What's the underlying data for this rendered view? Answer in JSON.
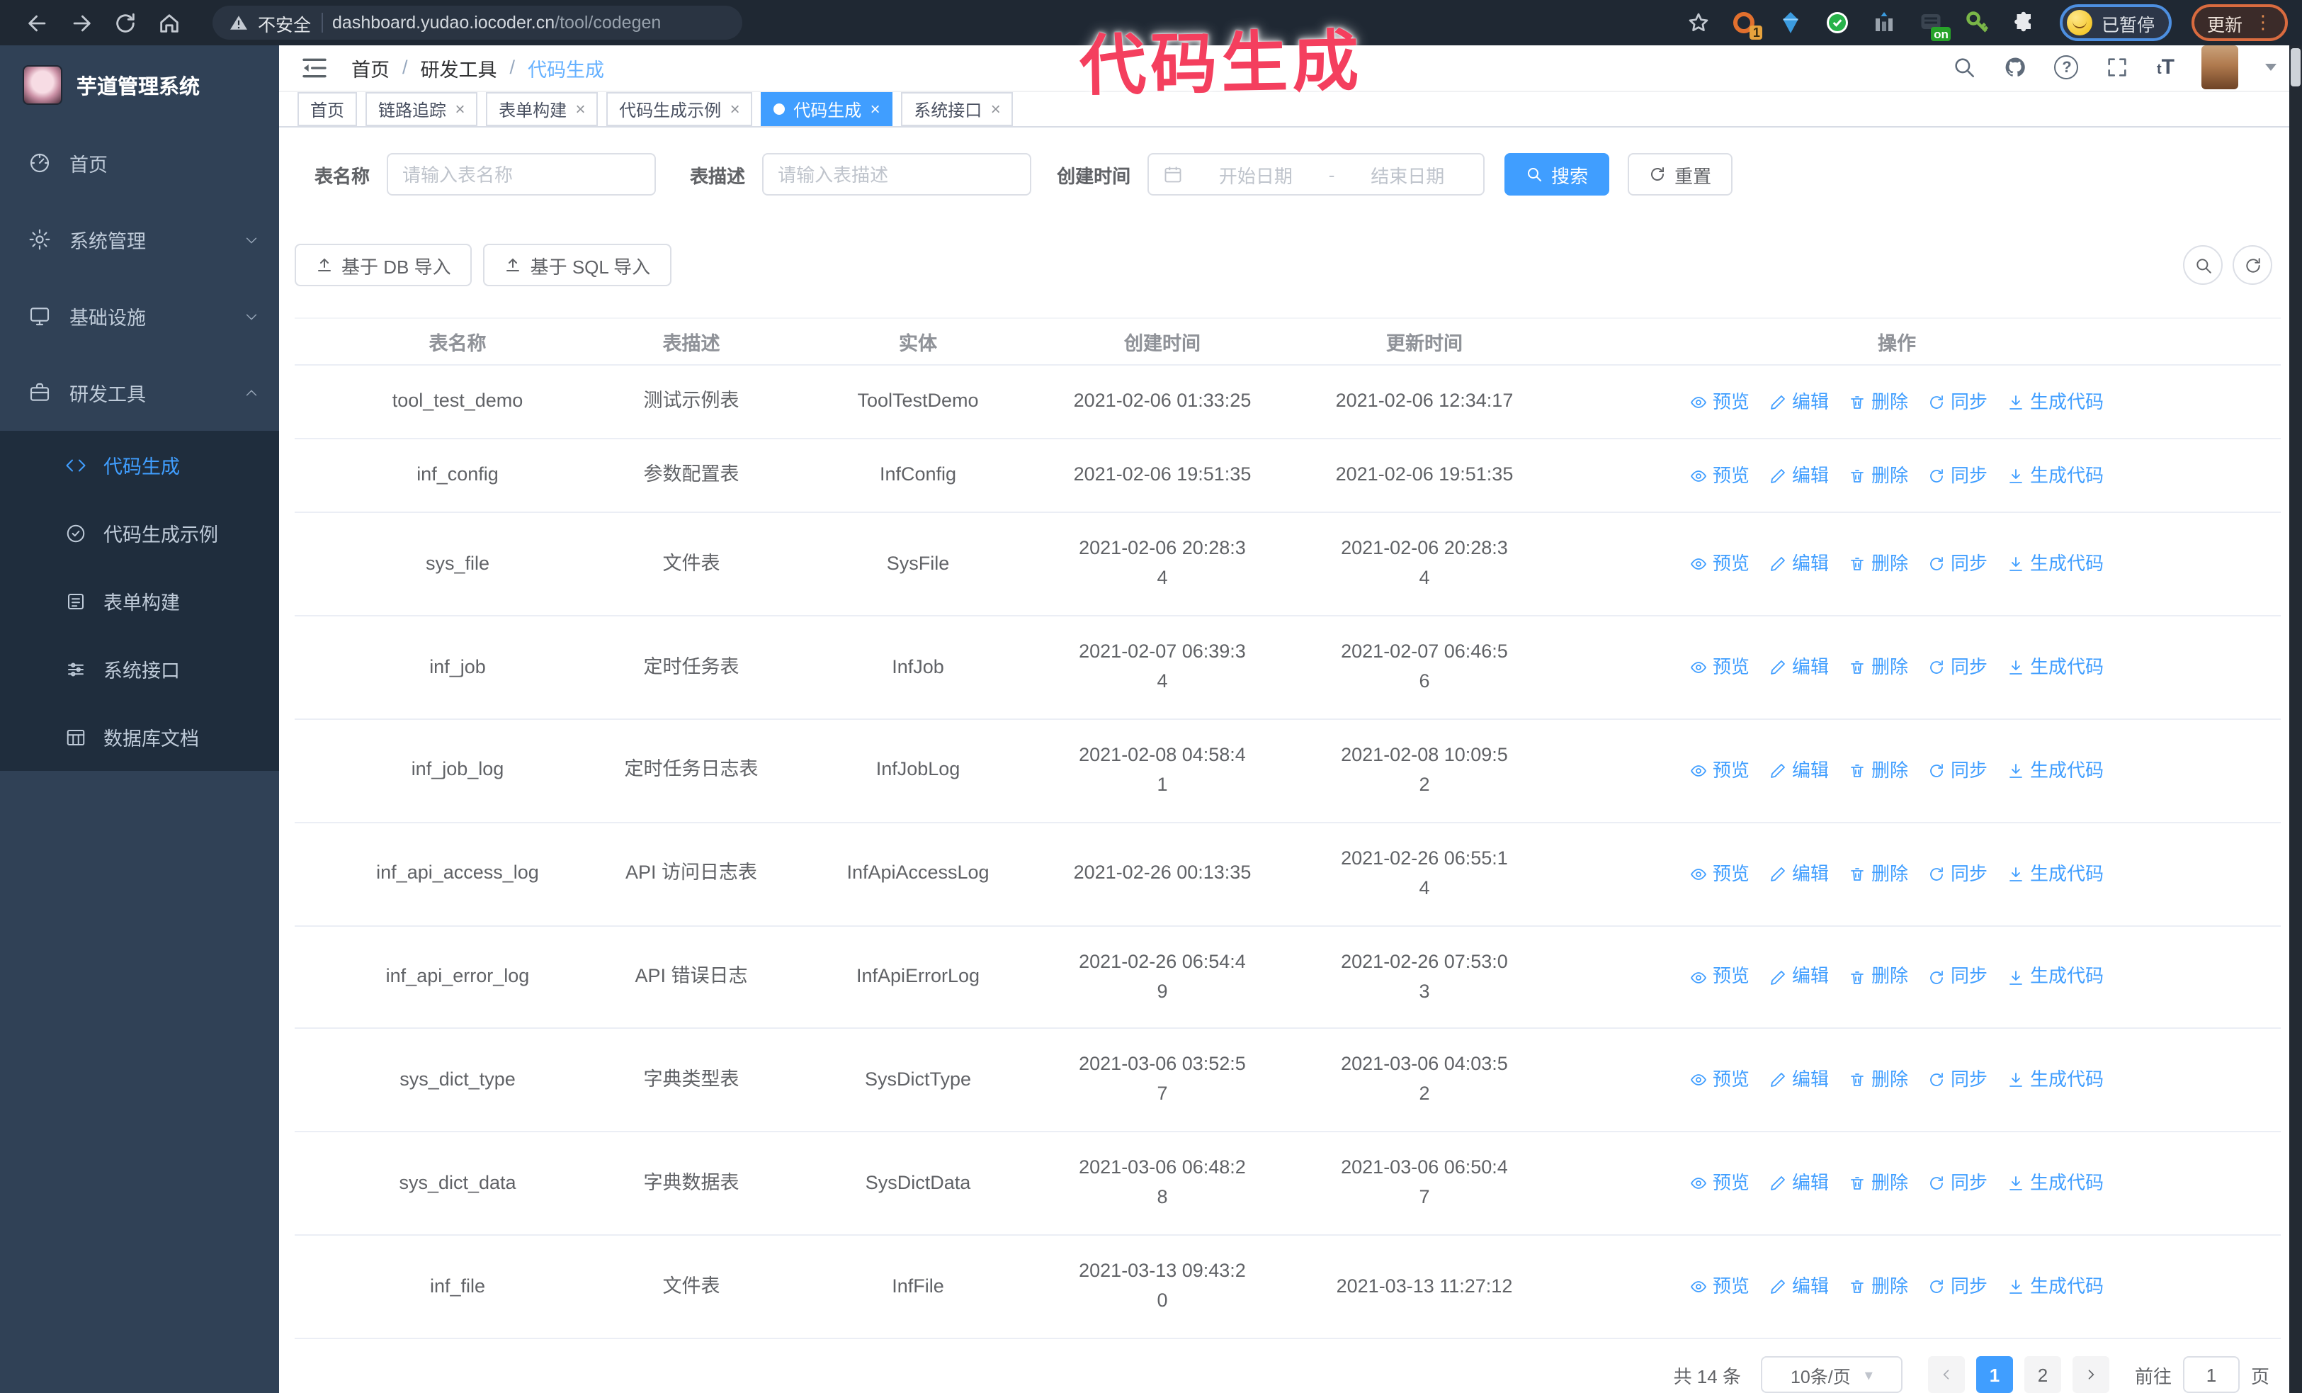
{
  "colors": {
    "accent": "#409eff",
    "annotation": "#f43f5e",
    "sidebar_bg": "#304156",
    "submenu_bg": "#1f2d3d",
    "chrome_bg": "#1f2833"
  },
  "glyphs": {
    "close": "×",
    "caret": "▾",
    "dots": "⋮",
    "sep": "/",
    "question": "?",
    "tT": "tT"
  },
  "browser": {
    "security_label": "不安全",
    "url_host": "dashboard.yudao.iocoder.cn",
    "url_path": "/tool/codegen",
    "extension_badge": "1",
    "extension_on_badge": "on",
    "profile_status": "已暂停",
    "update_label": "更新"
  },
  "annotation": {
    "text": "代码生成"
  },
  "sidebar": {
    "title": "芋道管理系统",
    "items": [
      {
        "label": "首页"
      },
      {
        "label": "系统管理"
      },
      {
        "label": "基础设施"
      },
      {
        "label": "研发工具"
      }
    ],
    "subitems": [
      {
        "label": "代码生成",
        "active": true
      },
      {
        "label": "代码生成示例"
      },
      {
        "label": "表单构建"
      },
      {
        "label": "系统接口"
      },
      {
        "label": "数据库文档"
      }
    ]
  },
  "header": {
    "breadcrumb": [
      "首页",
      "研发工具",
      "代码生成"
    ]
  },
  "tabs": [
    {
      "label": "首页",
      "closable": false,
      "active": false
    },
    {
      "label": "链路追踪",
      "closable": true,
      "active": false
    },
    {
      "label": "表单构建",
      "closable": true,
      "active": false
    },
    {
      "label": "代码生成示例",
      "closable": true,
      "active": false
    },
    {
      "label": "代码生成",
      "closable": true,
      "active": true
    },
    {
      "label": "系统接口",
      "closable": true,
      "active": false
    }
  ],
  "filters": {
    "table_name_label": "表名称",
    "table_name_placeholder": "请输入表名称",
    "table_desc_label": "表描述",
    "table_desc_placeholder": "请输入表描述",
    "create_time_label": "创建时间",
    "date_start_placeholder": "开始日期",
    "date_separator": "-",
    "date_end_placeholder": "结束日期",
    "search_label": "搜索",
    "reset_label": "重置"
  },
  "toolbar": {
    "import_db_label": "基于 DB 导入",
    "import_sql_label": "基于 SQL 导入"
  },
  "table": {
    "columns": [
      "表名称",
      "表描述",
      "实体",
      "创建时间",
      "更新时间",
      "操作"
    ],
    "actions": [
      "预览",
      "编辑",
      "删除",
      "同步",
      "生成代码"
    ],
    "rows": [
      {
        "name": "tool_test_demo",
        "desc": "测试示例表",
        "entity": "ToolTestDemo",
        "created": "2021-02-06 01:33:25",
        "updated": "2021-02-06 12:34:17"
      },
      {
        "name": "inf_config",
        "desc": "参数配置表",
        "entity": "InfConfig",
        "created": "2021-02-06 19:51:35",
        "updated": "2021-02-06 19:51:35"
      },
      {
        "name": "sys_file",
        "desc": "文件表",
        "entity": "SysFile",
        "created": "2021-02-06 20:28:3\n4",
        "updated": "2021-02-06 20:28:3\n4"
      },
      {
        "name": "inf_job",
        "desc": "定时任务表",
        "entity": "InfJob",
        "created": "2021-02-07 06:39:3\n4",
        "updated": "2021-02-07 06:46:5\n6"
      },
      {
        "name": "inf_job_log",
        "desc": "定时任务日志表",
        "entity": "InfJobLog",
        "created": "2021-02-08 04:58:4\n1",
        "updated": "2021-02-08 10:09:5\n2"
      },
      {
        "name": "inf_api_access_log",
        "desc": "API 访问日志表",
        "entity": "InfApiAccessLog",
        "created": "2021-02-26 00:13:35",
        "updated": "2021-02-26 06:55:1\n4"
      },
      {
        "name": "inf_api_error_log",
        "desc": "API 错误日志",
        "entity": "InfApiErrorLog",
        "created": "2021-02-26 06:54:4\n9",
        "updated": "2021-02-26 07:53:0\n3"
      },
      {
        "name": "sys_dict_type",
        "desc": "字典类型表",
        "entity": "SysDictType",
        "created": "2021-03-06 03:52:5\n7",
        "updated": "2021-03-06 04:03:5\n2"
      },
      {
        "name": "sys_dict_data",
        "desc": "字典数据表",
        "entity": "SysDictData",
        "created": "2021-03-06 06:48:2\n8",
        "updated": "2021-03-06 06:50:4\n7"
      },
      {
        "name": "inf_file",
        "desc": "文件表",
        "entity": "InfFile",
        "created": "2021-03-13 09:43:2\n0",
        "updated": "2021-03-13 11:27:12"
      }
    ]
  },
  "pagination": {
    "total": "共 14 条",
    "page_size": "10条/页",
    "pages": [
      {
        "num": "1",
        "active": true
      },
      {
        "num": "2",
        "active": false
      }
    ],
    "goto_label": "前往",
    "goto_value": "1",
    "page_unit": "页"
  }
}
